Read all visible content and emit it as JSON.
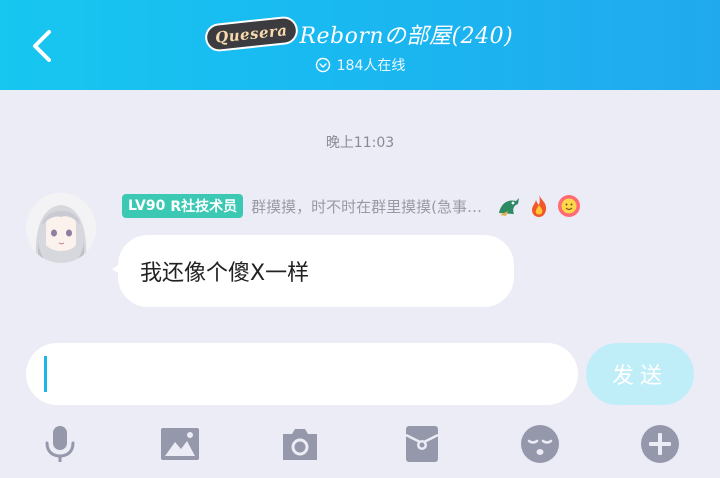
{
  "header": {
    "back_icon": "chevron-left-icon",
    "logo_text": "Quesera",
    "title": "Rebornの部屋(240)",
    "online_icon": "chevron-down-circle-icon",
    "online_text": "184人在线"
  },
  "messages": [
    {
      "timestamp": "晚上11:03",
      "sender": {
        "level": "LV90",
        "role": "R社技术员",
        "name": "群摸摸，时不时在群里摸摸(急事…",
        "icons": [
          "dragon-icon",
          "fire-icon",
          "smiley-badge-icon"
        ]
      },
      "text": "我还像个傻X一样"
    }
  ],
  "composer": {
    "placeholder": "",
    "value": "",
    "send_label": "发送"
  },
  "toolbar": {
    "items": [
      "microphone-icon",
      "image-icon",
      "camera-icon",
      "red-packet-icon",
      "emoji-icon",
      "plus-icon"
    ]
  },
  "colors": {
    "header_start": "#17c7f0",
    "header_end": "#21a9ee",
    "level_badge": "#3cc9b4",
    "send_button": "#bfeef9",
    "icon_gray": "#9597ab"
  }
}
